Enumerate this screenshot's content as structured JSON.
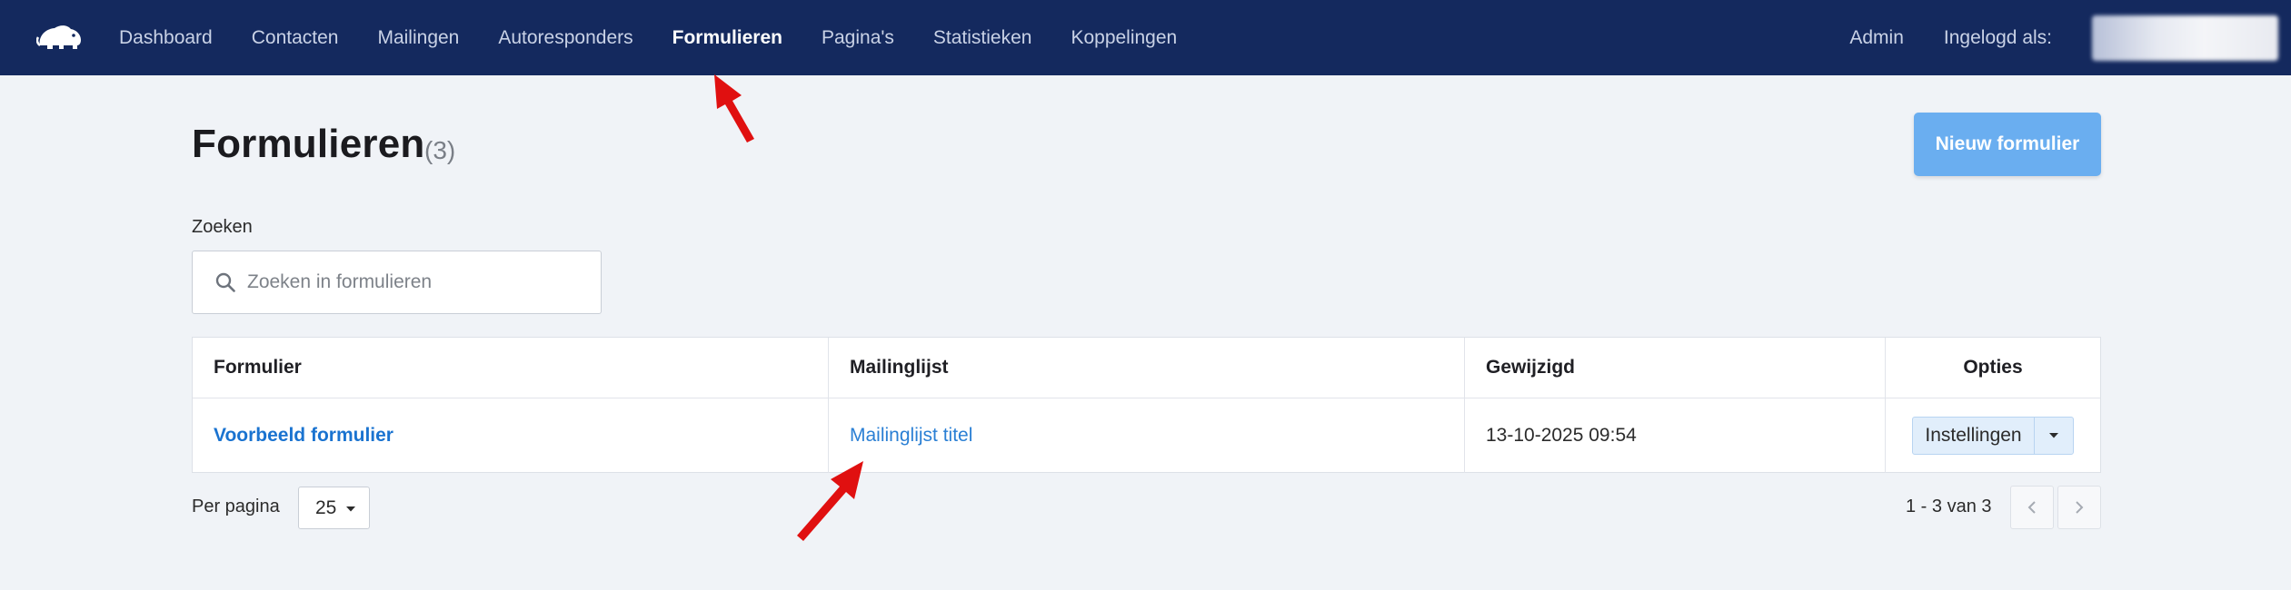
{
  "nav": {
    "items": [
      {
        "label": "Dashboard"
      },
      {
        "label": "Contacten"
      },
      {
        "label": "Mailingen"
      },
      {
        "label": "Autoresponders"
      },
      {
        "label": "Formulieren",
        "active": true
      },
      {
        "label": "Pagina's"
      },
      {
        "label": "Statistieken"
      },
      {
        "label": "Koppelingen"
      }
    ],
    "admin_label": "Admin",
    "logged_in_label": "Ingelogd als:"
  },
  "header": {
    "title": "Formulieren",
    "count": "(3)",
    "new_button": "Nieuw formulier"
  },
  "search": {
    "label": "Zoeken",
    "placeholder": "Zoeken in formulieren",
    "value": ""
  },
  "table": {
    "columns": [
      "Formulier",
      "Mailinglijst",
      "Gewijzigd",
      "Opties"
    ],
    "rows": [
      {
        "form": "Voorbeeld formulier",
        "list": "Mailinglijst titel",
        "modified": "13-10-2025 09:54",
        "options_button": "Instellingen"
      }
    ]
  },
  "footer": {
    "per_page_label": "Per pagina",
    "per_page_value": "25",
    "range_text": "1 - 3 van 3"
  },
  "colors": {
    "navbar": "#14295e",
    "accent": "#6aaef0",
    "link": "#1a73d0",
    "annotation": "#e01010"
  }
}
